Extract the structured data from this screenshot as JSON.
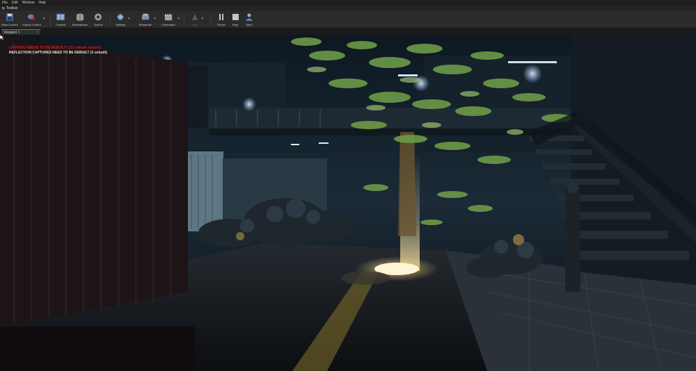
{
  "menu": {
    "items": [
      "File",
      "Edit",
      "Window",
      "Help"
    ]
  },
  "toolbar": {
    "title": "Toolbar",
    "buttons": [
      {
        "label": "Save Current",
        "icon": "save-icon",
        "color": "#4a6a9a"
      },
      {
        "label": "Source Control",
        "icon": "source-control-icon",
        "color": "#6c7ea0"
      },
      {
        "label": "Content",
        "icon": "content-browser-icon",
        "color": "#5a7cae"
      },
      {
        "label": "Marketplace",
        "icon": "marketplace-icon",
        "color": "#8a8a8a"
      },
      {
        "label": "Source",
        "icon": "settings-gear-icon",
        "color": "#9a9a9a"
      },
      {
        "label": "Settings",
        "icon": "world-settings-icon",
        "color": "#6a8fb0"
      },
      {
        "label": "Blueprints",
        "icon": "blueprints-icon",
        "color": "#7d8fa8"
      },
      {
        "label": "Cinematics",
        "icon": "cinematics-clapper-icon",
        "color": "#9aa4b0"
      },
      {
        "label": "Build",
        "icon": "build-icon",
        "color": "#555555"
      },
      {
        "label": "Pause",
        "icon": "pause-icon",
        "color": "#b8b8b8"
      },
      {
        "label": "Stop",
        "icon": "stop-icon",
        "color": "#b8b8b8"
      },
      {
        "label": "Eject",
        "icon": "eject-icon",
        "color": "#5f86c0"
      }
    ]
  },
  "viewport": {
    "tab_label": "Viewport 1",
    "lighting_message": "LIGHTING NEEDS TO BE REBUILT (123 unbuilt objects)",
    "reflection_message": "REFLECTION CAPTURES NEED TO BE REBUILT (3 unbuilt)"
  },
  "colors": {
    "accent": "#4a7ad0",
    "warning_red": "#d02020"
  }
}
